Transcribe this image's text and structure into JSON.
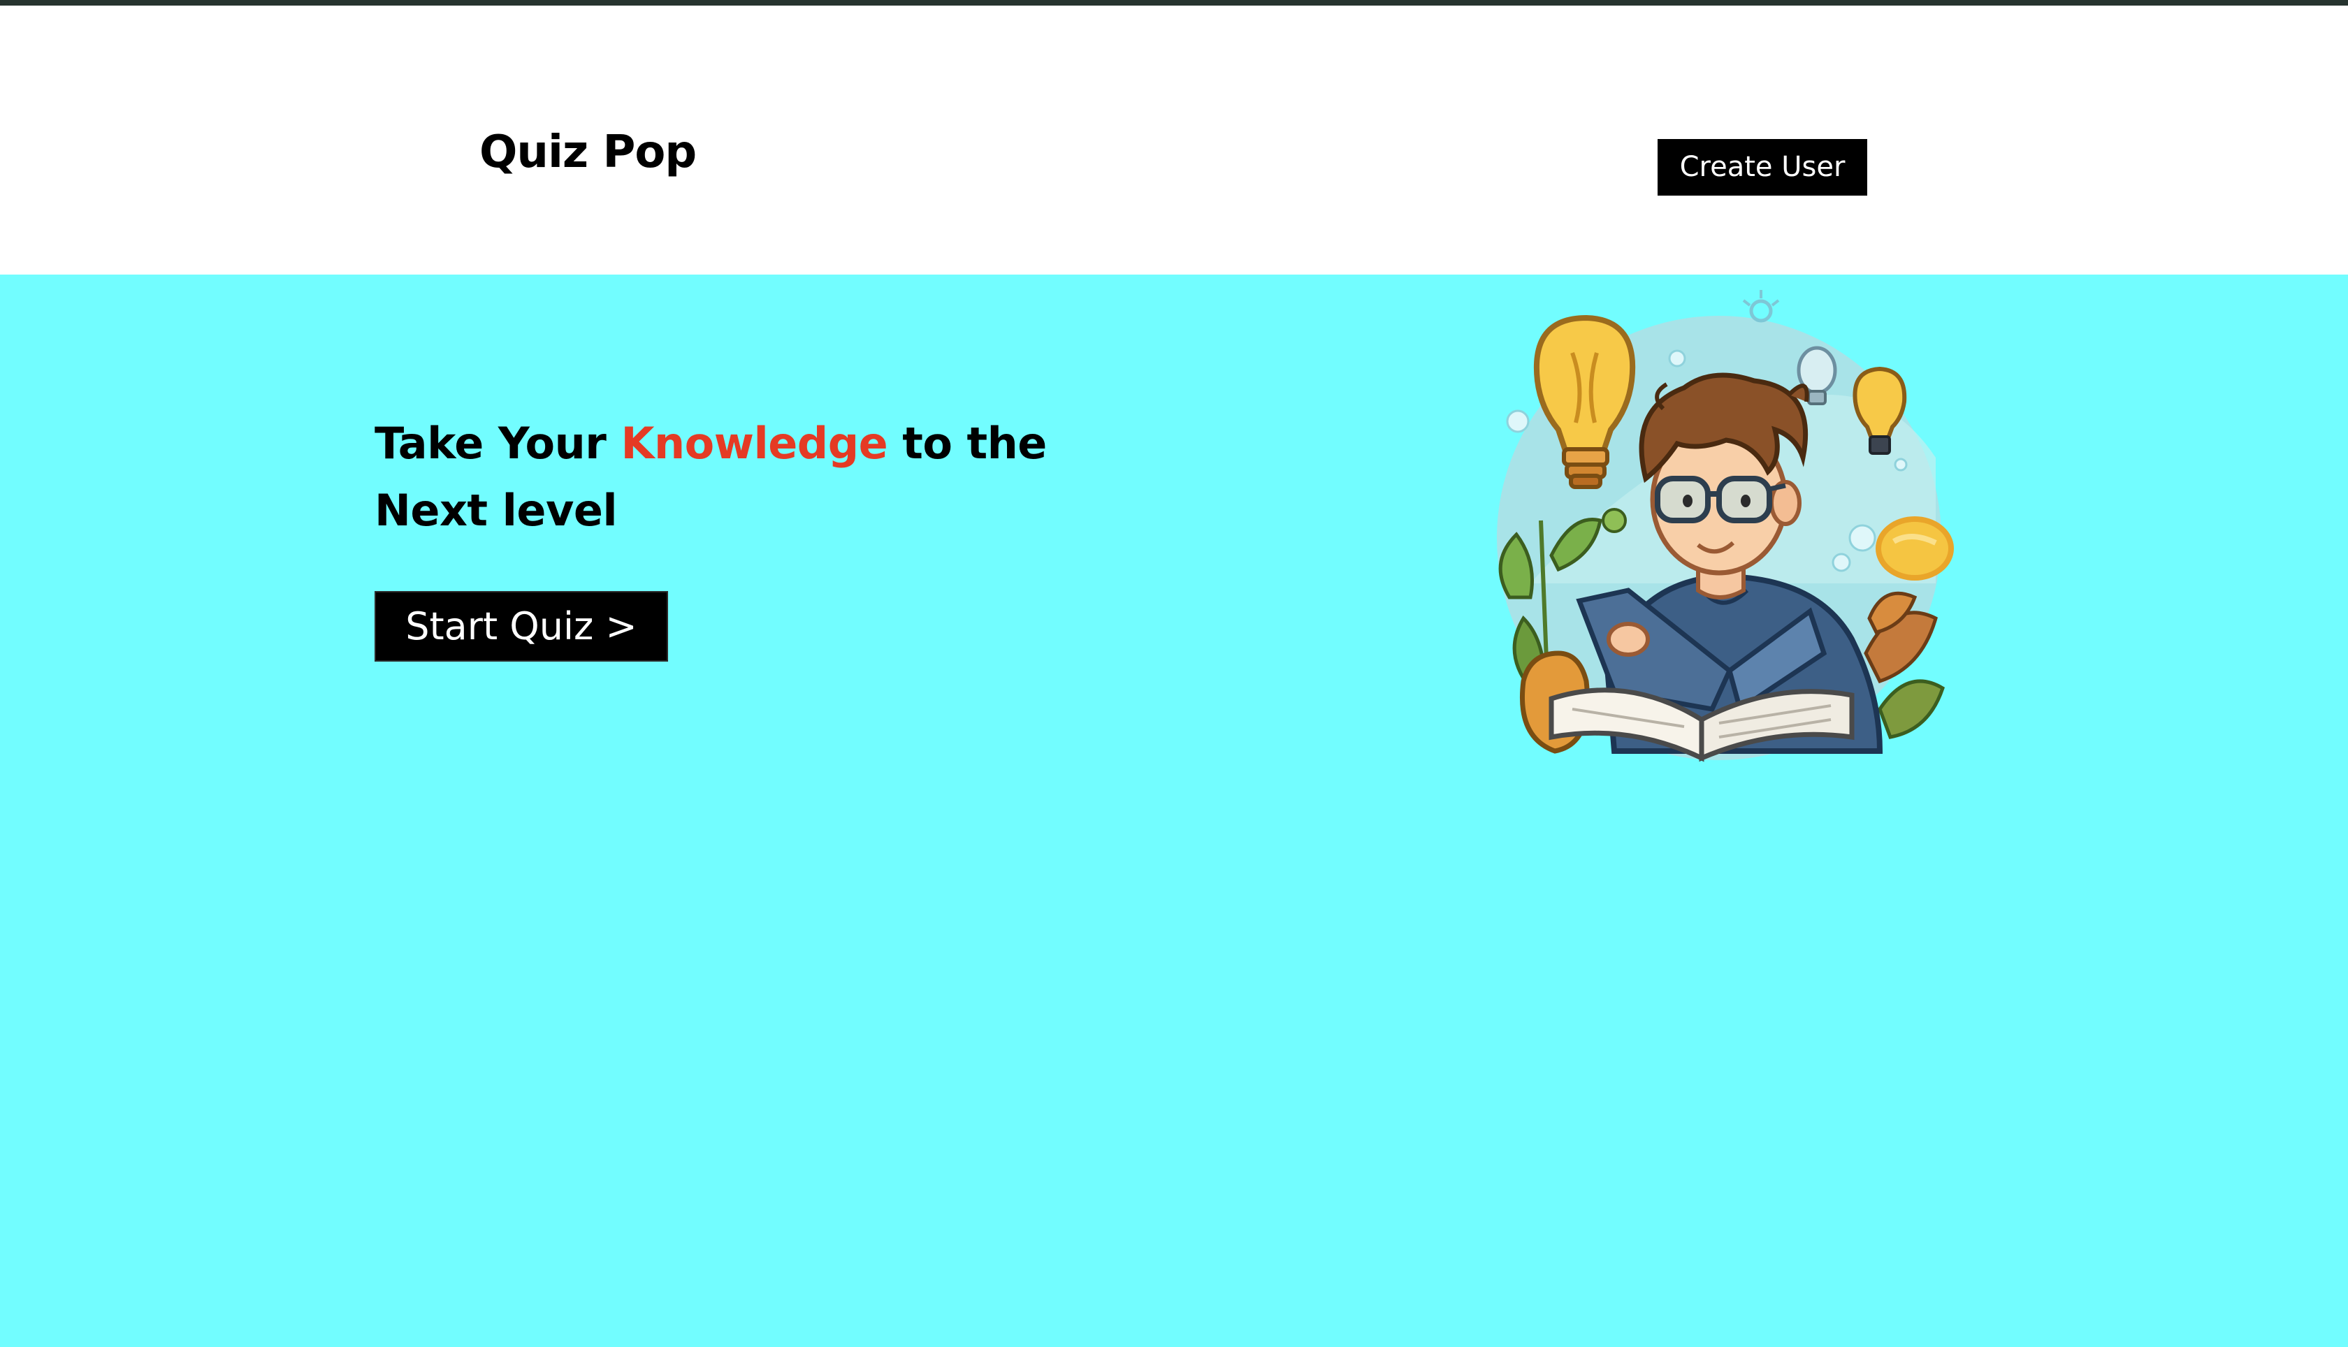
{
  "header": {
    "brand": "Quiz Pop",
    "create_user_label": "Create User"
  },
  "hero": {
    "headline_part1": "Take Your ",
    "headline_accent": "Knowledge",
    "headline_part2": " to the Next level",
    "start_quiz_label": "Start Quiz >"
  },
  "colors": {
    "top_strip": "#26342f",
    "header_bg": "#ffffff",
    "hero_bg": "#72fdff",
    "accent": "#e53a24",
    "button_bg": "#000000",
    "button_text": "#ffffff"
  },
  "icons": {
    "illustration": "student-reading-book-illustration"
  }
}
